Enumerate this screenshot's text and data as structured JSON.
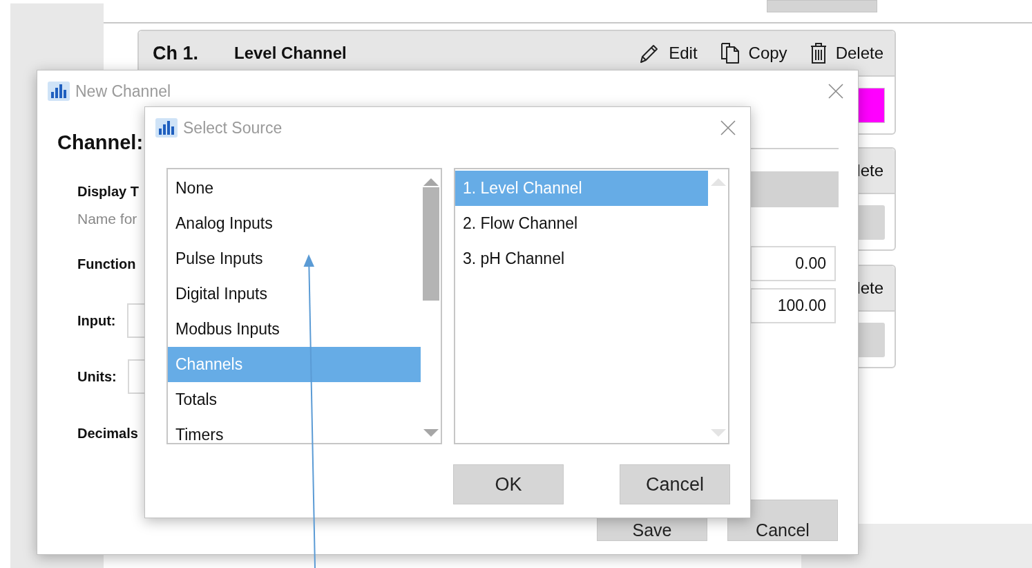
{
  "background": {
    "card": {
      "number": "Ch 1.",
      "name": "Level Channel",
      "color": "#ff00ff",
      "actions": [
        {
          "kind": "edit",
          "label": "Edit"
        },
        {
          "kind": "copy",
          "label": "Copy"
        },
        {
          "kind": "delete",
          "label": "Delete"
        }
      ]
    },
    "partial_cards": [
      {
        "action": "lete"
      },
      {
        "action": "lete"
      }
    ]
  },
  "new_channel": {
    "title": "New Channel",
    "heading": "Channel:",
    "labels": [
      {
        "kind": "label",
        "text": "Display T"
      },
      {
        "kind": "hint",
        "text": "Name for"
      },
      {
        "kind": "label",
        "text": "Function"
      },
      {
        "kind": "field",
        "text": "Input:"
      },
      {
        "kind": "field",
        "text": "Units:"
      },
      {
        "kind": "label",
        "text": "Decimals"
      }
    ],
    "values": [
      "0.00",
      "100.00"
    ],
    "buttons": [
      "Save",
      "Cancel"
    ]
  },
  "select_source": {
    "title": "Select Source",
    "categories": [
      {
        "label": "None",
        "selected": false
      },
      {
        "label": "Analog Inputs",
        "selected": false
      },
      {
        "label": "Pulse Inputs",
        "selected": false
      },
      {
        "label": "Digital Inputs",
        "selected": false
      },
      {
        "label": "Modbus Inputs",
        "selected": false
      },
      {
        "label": "Channels",
        "selected": true
      },
      {
        "label": "Totals",
        "selected": false
      },
      {
        "label": "Timers",
        "selected": false
      }
    ],
    "sources": [
      {
        "label": "1. Level Channel",
        "selected": true
      },
      {
        "label": "2. Flow Channel",
        "selected": false
      },
      {
        "label": "3. pH Channel",
        "selected": false
      }
    ],
    "buttons": [
      "OK",
      "Cancel"
    ]
  }
}
